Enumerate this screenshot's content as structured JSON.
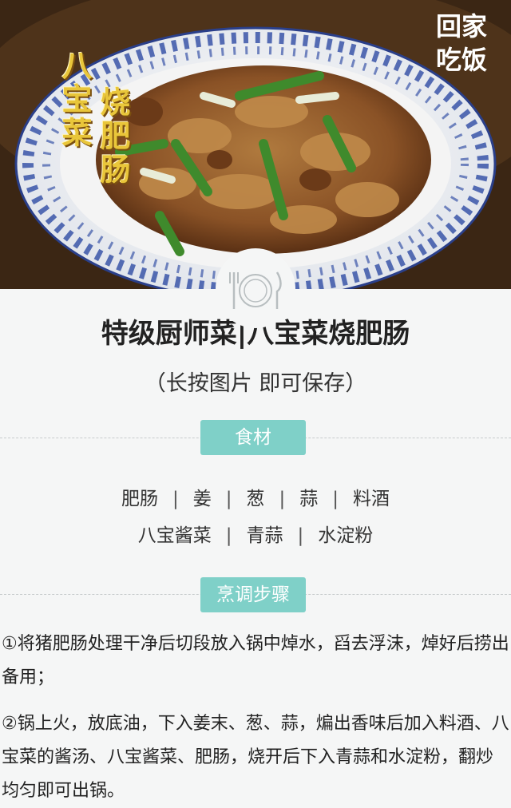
{
  "hero": {
    "title_col1": "八宝菜",
    "title_col2": "烧肥肠",
    "logo_line1": "回家",
    "logo_line2": "吃饭"
  },
  "header": {
    "title": "特级厨师菜|八宝菜烧肥肠",
    "subtitle": "（长按图片  即可保存）"
  },
  "ingredients": {
    "label": "食材",
    "row1": [
      "肥肠",
      "姜",
      "葱",
      "蒜",
      "料酒"
    ],
    "row2": [
      "八宝酱菜",
      "青蒜",
      "水淀粉"
    ],
    "separator": "|"
  },
  "steps": {
    "label": "烹调步骤",
    "items": [
      "①将猪肥肠处理干净后切段放入锅中焯水，舀去浮沫，焯好后捞出备用；",
      "②锅上火，放底油，下入姜末、葱、蒜，煸出香味后加入料酒、八宝菜的酱汤、八宝酱菜、肥肠，烧开后下入青蒜和水淀粉，翻炒均匀即可出锅。"
    ]
  },
  "colors": {
    "accent": "#7fd0c8",
    "title_gold": "#e9c63a",
    "text": "#222222",
    "background": "#f5f6f6"
  }
}
